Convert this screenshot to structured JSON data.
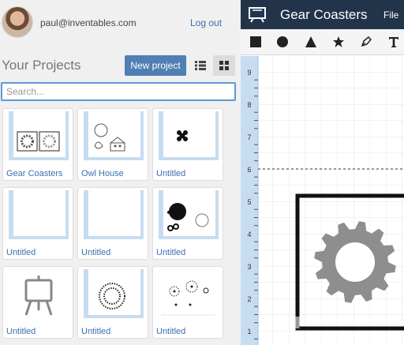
{
  "user": {
    "email": "paul@inventables.com",
    "logout_label": "Log out"
  },
  "projects": {
    "title": "Your Projects",
    "new_label": "New project",
    "search_placeholder": "Search...",
    "items": [
      {
        "label": "Gear Coasters",
        "thumb": "gear-coasters"
      },
      {
        "label": "Owl House",
        "thumb": "owl-house"
      },
      {
        "label": "Untitled",
        "thumb": "clover"
      },
      {
        "label": "Untitled",
        "thumb": "blank"
      },
      {
        "label": "Untitled",
        "thumb": "blank"
      },
      {
        "label": "Untitled",
        "thumb": "dots"
      },
      {
        "label": "Untitled",
        "thumb": "easel"
      },
      {
        "label": "Untitled",
        "thumb": "rings"
      },
      {
        "label": "Untitled",
        "thumb": "circles"
      }
    ]
  },
  "editor": {
    "title": "Gear Coasters",
    "file_menu": "File",
    "tools": [
      "square-tool-icon",
      "circle-tool-icon",
      "triangle-tool-icon",
      "star-tool-icon",
      "pen-tool-icon",
      "text-tool-icon"
    ],
    "ruler_labels": [
      "9",
      "8",
      "7",
      "6",
      "5",
      "4",
      "3",
      "2",
      "1"
    ],
    "colors": {
      "accent": "#4f7fb3",
      "topbar": "#22344a",
      "grid": "#cfe2f3",
      "ruler": "#c6dcf0"
    }
  }
}
